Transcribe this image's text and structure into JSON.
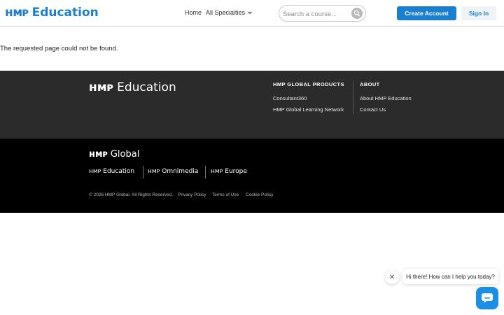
{
  "header": {
    "logo_mark": "ʜᴍᴘ",
    "logo_word": "Education",
    "nav_home": "Home",
    "nav_specialties": "All Specialties",
    "search_placeholder": "Search a course...",
    "create_account": "Create Account",
    "sign_in": "Sign In"
  },
  "main": {
    "message": "The requested page could not be found."
  },
  "footer": {
    "logo_mark": "ʜᴍᴘ",
    "logo_word": "Education",
    "products_heading": "HMP GLOBAL PRODUCTS",
    "products": [
      "Consultant360",
      "HMP Global Learning Network"
    ],
    "about_heading": "ABOUT",
    "about_links": [
      "About HMP Education",
      "Contact Us"
    ]
  },
  "global_footer": {
    "logo_mark": "ʜᴍᴘ",
    "logo_word": "Global",
    "brands": [
      "ʜᴍᴘ Education",
      "ʜᴍᴘ Omnimedia",
      "ʜᴍᴘ Europe"
    ],
    "copyright": "© 2026 HMP Global. All Rights Reserved.",
    "legal_links": [
      "Privacy Policy",
      "Terms of Use",
      "Cookie Policy"
    ]
  },
  "chat": {
    "greeting": "Hi there! How can I help you today?",
    "close_glyph": "✕"
  },
  "colors": {
    "accent": "#1b7fd1",
    "footer_dark": "#2b2b2b",
    "footer_black": "#000000",
    "chat_button": "#1b8fe4"
  }
}
